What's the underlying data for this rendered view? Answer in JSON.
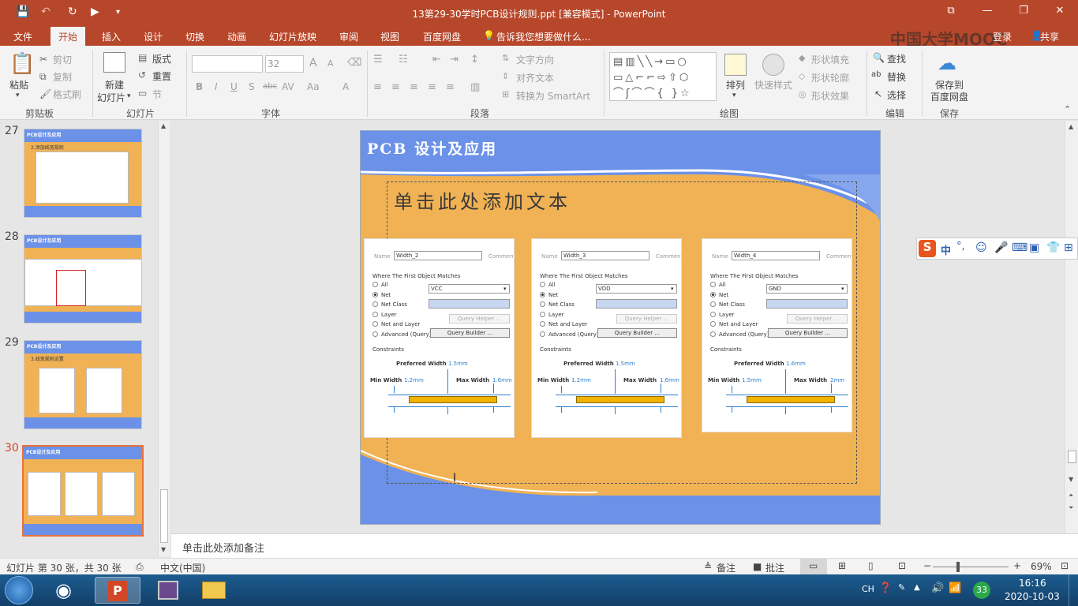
{
  "window": {
    "title": "13第29-30学时PCB设计规则.ppt [兼容模式] - PowerPoint",
    "controls": {
      "restore_ribbon": "⧉",
      "minimize": "—",
      "maximize": "❐",
      "close": "✕"
    }
  },
  "tabs": [
    "文件",
    "开始",
    "插入",
    "设计",
    "切换",
    "动画",
    "幻灯片放映",
    "审阅",
    "视图",
    "百度网盘"
  ],
  "tell_me": "告诉我您想要做什么...",
  "share": "共享",
  "login": "登录",
  "watermark": "中国大学MOOC",
  "ribbon": {
    "clipboard": {
      "paste": "粘贴",
      "cut": "剪切",
      "copy": "复制",
      "format_painter": "格式刷",
      "group": "剪贴板"
    },
    "slides": {
      "new_slide": "新建",
      "new_slide2": "幻灯片",
      "layout": "版式",
      "reset": "重置",
      "section": "节",
      "group": "幻灯片"
    },
    "font": {
      "size": "32",
      "group": "字体",
      "bold": "B",
      "italic": "I",
      "underline": "U",
      "shadow": "S",
      "strike": "abc",
      "spacing": "AV",
      "case": "Aa",
      "grow": "A",
      "shrink": "A",
      "color": "A"
    },
    "paragraph": {
      "text_direction": "文字方向",
      "align_text": "对齐文本",
      "smartart": "转换为 SmartArt",
      "group": "段落"
    },
    "drawing": {
      "arrange": "排列",
      "quick_styles": "快速样式",
      "shape_fill": "形状填充",
      "shape_outline": "形状轮廓",
      "shape_effects": "形状效果",
      "group": "绘图"
    },
    "editing": {
      "find": "查找",
      "replace": "替换",
      "select": "选择",
      "group": "编辑"
    },
    "save": {
      "save_to": "保存到",
      "baidu": "百度网盘",
      "group": "保存"
    }
  },
  "thumbnails": [
    {
      "num": "27",
      "title": "PCB设计及应用",
      "subtitle": "2.添加线宽规则"
    },
    {
      "num": "28",
      "title": "PCB设计及应用",
      "subtitle": ""
    },
    {
      "num": "29",
      "title": "PCB设计及应用",
      "subtitle": "3.线宽规则设置"
    },
    {
      "num": "30",
      "title": "PCB设计及应用",
      "subtitle": ""
    }
  ],
  "slide": {
    "title": "PCB 设计及应用",
    "placeholder": "单击此处添加文本",
    "panels": [
      {
        "name_label": "Name",
        "name": "Width_2",
        "comment": "Comment",
        "where": "Where The First Object Matches",
        "options": [
          "All",
          "Net",
          "Net Class",
          "Layer",
          "Net and Layer",
          "Advanced (Query)"
        ],
        "net": "VCC",
        "query_helper": "Query Helper ...",
        "query_builder": "Query Builder ...",
        "constraints": "Constraints",
        "pref_label": "Preferred Width",
        "pref": "1.5mm",
        "min_label": "Min Width",
        "min": "1.2mm",
        "max_label": "Max Width",
        "max": "1.6mm"
      },
      {
        "name_label": "Name",
        "name": "Width_3",
        "comment": "Comment",
        "where": "Where The First Object Matches",
        "options": [
          "All",
          "Net",
          "Net Class",
          "Layer",
          "Net and Layer",
          "Advanced (Query)"
        ],
        "net": "VDD",
        "query_helper": "Query Helper ...",
        "query_builder": "Query Builder ...",
        "constraints": "Constraints",
        "pref_label": "Preferred Width",
        "pref": "1.5mm",
        "min_label": "Min Width",
        "min": "1.2mm",
        "max_label": "Max Width",
        "max": "1.6mm"
      },
      {
        "name_label": "Name",
        "name": "Width_4",
        "comment": "Comment",
        "where": "Where The First Object Matches",
        "options": [
          "All",
          "Net",
          "Net Class",
          "Layer",
          "Net and Layer",
          "Advanced (Query)"
        ],
        "net": "GND",
        "query_helper": "Query Helper ...",
        "query_builder": "Query Builder ...",
        "constraints": "Constraints",
        "pref_label": "Preferred Width",
        "pref": "1.6mm",
        "min_label": "Min Width",
        "min": "1.5mm",
        "max_label": "Max Width",
        "max": "2mm"
      }
    ]
  },
  "notes_placeholder": "单击此处添加备注",
  "status": {
    "slide_info": "幻灯片 第 30 张，共 30 张",
    "language": "中文(中国)",
    "notes": "备注",
    "comments": "批注",
    "zoom": "69%",
    "minus": "−",
    "plus": "+"
  },
  "ime": {
    "mode": "中"
  },
  "taskbar": {
    "lang": "CH",
    "time": "16:16",
    "date": "2020-10-03",
    "badge": "33"
  },
  "colors": {
    "accent": "#b7472a",
    "slide_bg": "#f0b254",
    "slide_band": "#6b91e8"
  }
}
